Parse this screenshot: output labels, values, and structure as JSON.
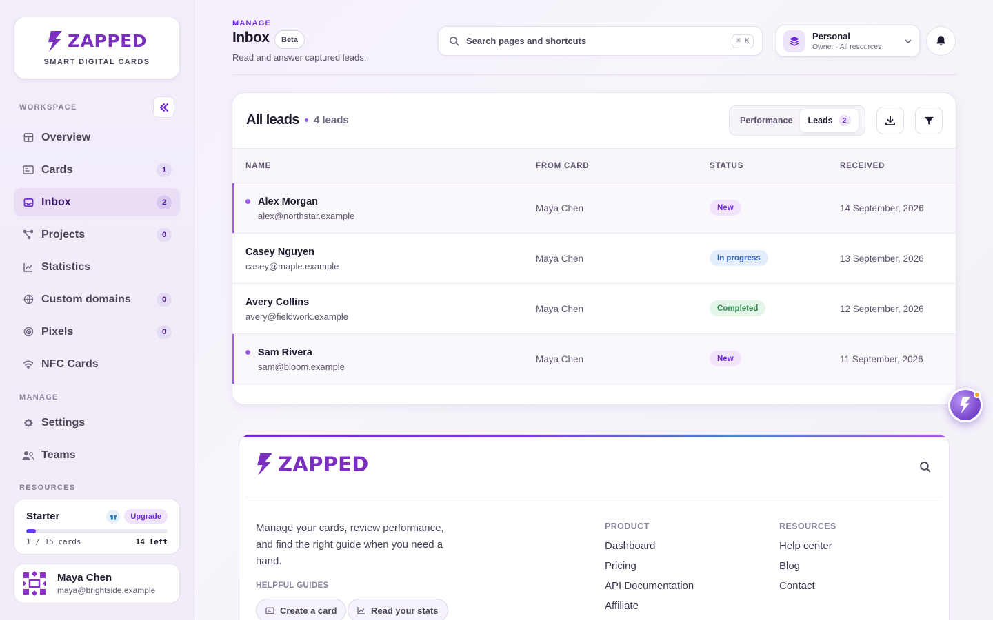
{
  "sidebar": {
    "brand": {
      "name": "ZAPPED",
      "tagline": "SMART DIGITAL CARDS"
    },
    "workspace_label": "WORKSPACE",
    "workspace_items": [
      {
        "label": "Overview",
        "icon": "grid-icon",
        "count": null
      },
      {
        "label": "Cards",
        "icon": "id-card-icon",
        "count": "1"
      },
      {
        "label": "Inbox",
        "icon": "inbox-icon",
        "count": "2",
        "active": true
      },
      {
        "label": "Projects",
        "icon": "nodes-icon",
        "count": "0"
      },
      {
        "label": "Statistics",
        "icon": "chart-icon",
        "count": null
      },
      {
        "label": "Custom domains",
        "icon": "globe-icon",
        "count": "0"
      },
      {
        "label": "Pixels",
        "icon": "target-icon",
        "count": "0"
      },
      {
        "label": "NFC Cards",
        "icon": "wifi-icon",
        "count": null
      }
    ],
    "manage_label": "MANAGE",
    "manage_items": [
      {
        "label": "Settings",
        "icon": "gear-icon"
      },
      {
        "label": "Teams",
        "icon": "users-icon"
      }
    ],
    "resources_label": "RESOURCES",
    "plan": {
      "name": "Starter",
      "upgrade_label": "Upgrade",
      "usage_text": "1 / 15 cards",
      "remaining_text": "14 left",
      "usage_fraction": 0.0667
    },
    "user": {
      "name": "Maya Chen",
      "email": "maya@brightside.example"
    }
  },
  "header": {
    "eyebrow": "MANAGE",
    "title": "Inbox",
    "badge": "Beta",
    "subtitle": "Read and answer captured leads.",
    "search_placeholder": "Search pages and shortcuts",
    "search_shortcut": "⌘ K",
    "account": {
      "name": "Personal",
      "subtitle": "Owner · All resources"
    }
  },
  "leads": {
    "title": "All leads",
    "count_text": "4 leads",
    "tabs": [
      {
        "label": "Performance",
        "active": false
      },
      {
        "label": "Leads",
        "active": true,
        "count": "2"
      }
    ],
    "columns": [
      "NAME",
      "FROM CARD",
      "STATUS",
      "RECEIVED"
    ],
    "rows": [
      {
        "name": "Alex Morgan",
        "email": "alex@northstar.example",
        "card": "Maya Chen",
        "status": "New",
        "received": "14 September, 2026",
        "unread": true
      },
      {
        "name": "Casey Nguyen",
        "email": "casey@maple.example",
        "card": "Maya Chen",
        "status": "In progress",
        "received": "13 September, 2026",
        "unread": false
      },
      {
        "name": "Avery Collins",
        "email": "avery@fieldwork.example",
        "card": "Maya Chen",
        "status": "Completed",
        "received": "12 September, 2026",
        "unread": false
      },
      {
        "name": "Sam Rivera",
        "email": "sam@bloom.example",
        "card": "Maya Chen",
        "status": "New",
        "received": "11 September, 2026",
        "unread": true
      }
    ],
    "status_colors": {
      "New": {
        "bg": "#f1e4fb",
        "fg": "#6d28d9"
      },
      "In progress": {
        "bg": "#e3edfb",
        "fg": "#2f5fb8"
      },
      "Completed": {
        "bg": "#e4f5ea",
        "fg": "#2f8a4c"
      }
    }
  },
  "footer": {
    "brand": "ZAPPED",
    "description": "Manage your cards, review performance, and find the right guide when you need a hand.",
    "guides_label": "HELPFUL GUIDES",
    "guides": [
      {
        "label": "Create a card",
        "icon": "id-card-icon"
      },
      {
        "label": "Read your stats",
        "icon": "chart-icon"
      }
    ],
    "product_label": "PRODUCT",
    "product_links": [
      "Dashboard",
      "Pricing",
      "API Documentation",
      "Affiliate"
    ],
    "resources_label": "RESOURCES",
    "resources_links": [
      "Help center",
      "Blog",
      "Contact"
    ]
  },
  "colors": {
    "accent": "#6d28d9",
    "brand": "#7b2fbe"
  }
}
